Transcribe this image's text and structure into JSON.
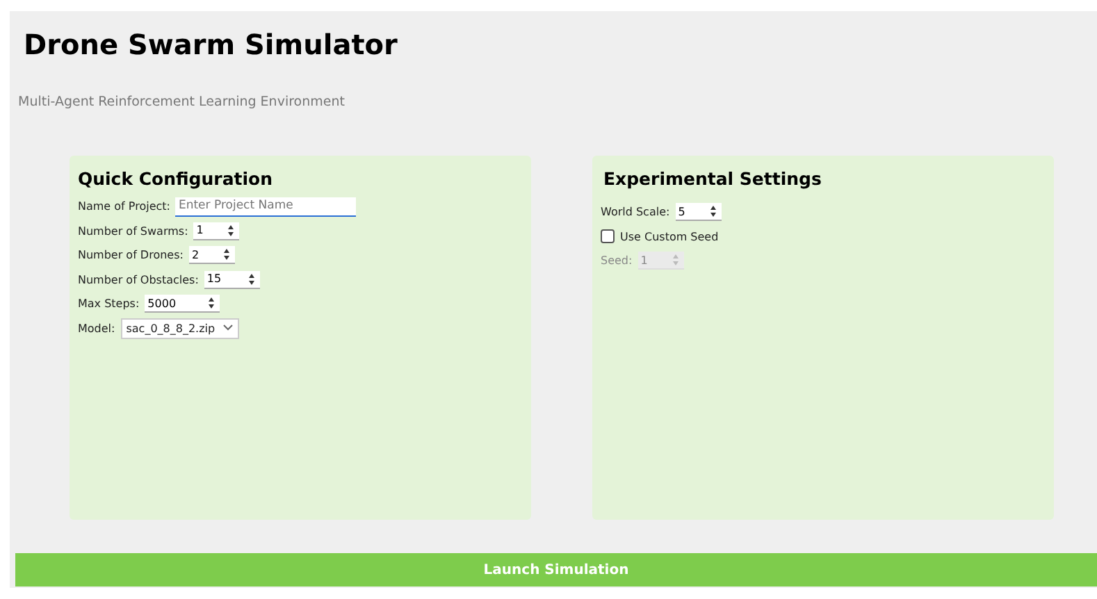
{
  "title": "Drone Swarm Simulator",
  "subtitle": "Multi-Agent Reinforcement Learning Environment",
  "panels": [
    {
      "title": "Quick Configuration",
      "fields": [
        {
          "kind": "text",
          "label": "Name of Project:",
          "placeholder": "Enter Project Name"
        },
        {
          "kind": "spin",
          "label": "Number of Swarms:",
          "value": "1"
        },
        {
          "kind": "spin",
          "label": "Number of Drones:",
          "value": "2"
        },
        {
          "kind": "spin",
          "label": "Number of Obstacles:",
          "value": "15"
        },
        {
          "kind": "spin",
          "label": "Max Steps:",
          "value": "5000"
        },
        {
          "kind": "select",
          "label": "Model:",
          "value": "sac_0_8_8_2.zip"
        }
      ]
    },
    {
      "title": "Experimental Settings",
      "fields": [
        {
          "kind": "spin",
          "label": "World Scale:",
          "value": "5",
          "disabled": false
        },
        {
          "kind": "checkbox",
          "label": "Use Custom Seed",
          "checked": false
        },
        {
          "kind": "spin",
          "label": "Seed:",
          "value": "1",
          "disabled": true
        }
      ]
    }
  ],
  "launch_button": "Launch Simulation"
}
